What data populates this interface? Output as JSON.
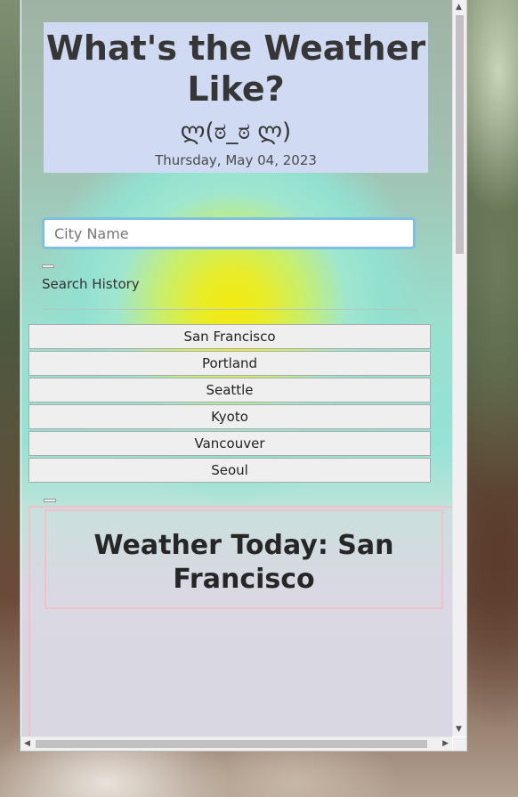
{
  "header": {
    "title": "What's the Weather Like?",
    "emoticon": "ლ(ಠ_ಠ ლ)",
    "date": "Thursday, May 04, 2023"
  },
  "search": {
    "placeholder": "City Name",
    "value": ""
  },
  "history": {
    "label": "Search History",
    "items": [
      "San Francisco",
      "Portland",
      "Seattle",
      "Kyoto",
      "Vancouver",
      "Seoul"
    ]
  },
  "today": {
    "title": "Weather Today: San Francisco"
  },
  "colors": {
    "header_bg": "#d0daf2",
    "input_border": "#7fc0de",
    "panel_border": "#f2bfcb"
  },
  "icons": {
    "scroll_up": "scroll-up-arrow",
    "scroll_down": "scroll-down-arrow",
    "scroll_left": "scroll-left-arrow",
    "scroll_right": "scroll-right-arrow"
  }
}
